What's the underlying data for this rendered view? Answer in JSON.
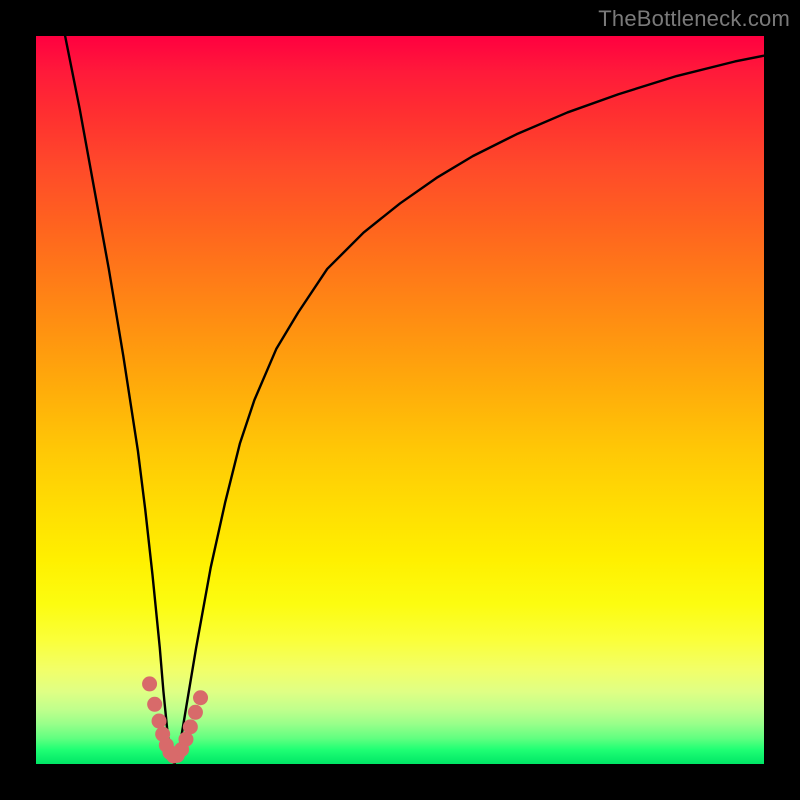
{
  "attribution": "TheBottleneck.com",
  "colors": {
    "frame": "#000000",
    "curve_stroke": "#000000",
    "marker_fill": "#d86a6a",
    "gradient_stops": [
      "#ff0040",
      "#ff1a3a",
      "#ff3030",
      "#ff4a2a",
      "#ff6020",
      "#ff7a18",
      "#ff9410",
      "#ffae0a",
      "#ffc806",
      "#ffde02",
      "#fff000",
      "#fcfc10",
      "#faff3a",
      "#f2ff68",
      "#e0ff84",
      "#c0ff8c",
      "#98ff8a",
      "#60ff80",
      "#20ff74",
      "#00e666"
    ]
  },
  "chart_data": {
    "type": "line",
    "title": "",
    "xlabel": "",
    "ylabel": "",
    "xlim": [
      0,
      100
    ],
    "ylim": [
      0,
      100
    ],
    "series": [
      {
        "name": "bottleneck-curve",
        "x": [
          4,
          6,
          8,
          10,
          12,
          14,
          15,
          16,
          17,
          17.5,
          18,
          18.5,
          19,
          19.5,
          20,
          21,
          22,
          24,
          26,
          28,
          30,
          33,
          36,
          40,
          45,
          50,
          55,
          60,
          66,
          73,
          80,
          88,
          96,
          100
        ],
        "y": [
          100,
          90,
          79,
          68,
          56,
          43,
          35,
          26,
          16,
          10,
          5,
          1,
          0,
          1,
          4,
          10,
          16,
          27,
          36,
          44,
          50,
          57,
          62,
          68,
          73,
          77,
          80.5,
          83.5,
          86.5,
          89.5,
          92,
          94.5,
          96.5,
          97.3
        ]
      }
    ],
    "markers": {
      "name": "highlighted-points",
      "x": [
        15.6,
        16.3,
        16.9,
        17.4,
        17.9,
        18.4,
        18.9,
        19.4,
        20.0,
        20.6,
        21.2,
        21.9,
        22.6
      ],
      "y": [
        11.0,
        8.2,
        5.9,
        4.1,
        2.6,
        1.6,
        1.1,
        1.2,
        2.0,
        3.4,
        5.1,
        7.1,
        9.1
      ]
    },
    "note": "Values estimated from pixel positions of the curve and markers; y=0 is bottom (green), y=100 is top (red)."
  }
}
